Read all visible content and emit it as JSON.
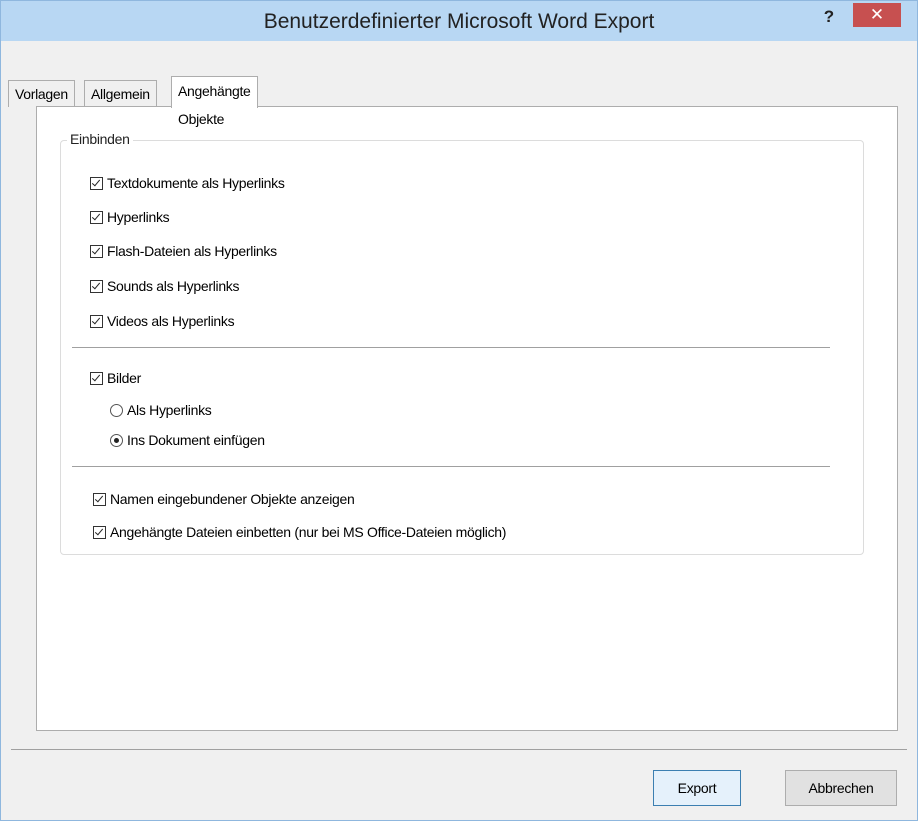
{
  "window": {
    "title": "Benutzerdefinierter Microsoft Word Export",
    "help_label": "?",
    "close_label": "✕"
  },
  "tabs": [
    {
      "label": "Vorlagen",
      "active": false
    },
    {
      "label": "Allgemein",
      "active": false
    },
    {
      "label": "Angehängte Objekte",
      "active": true
    }
  ],
  "group": {
    "label": "Einbinden",
    "hyperlink_options": [
      {
        "label": "Textdokumente als Hyperlinks",
        "checked": true
      },
      {
        "label": "Hyperlinks",
        "checked": true
      },
      {
        "label": "Flash-Dateien als Hyperlinks",
        "checked": true
      },
      {
        "label": "Sounds als Hyperlinks",
        "checked": true
      },
      {
        "label": "Videos als Hyperlinks",
        "checked": true
      }
    ],
    "images": {
      "label": "Bilder",
      "checked": true,
      "radios": [
        {
          "label": "Als Hyperlinks",
          "selected": false
        },
        {
          "label": "Ins Dokument einfügen",
          "selected": true
        }
      ]
    },
    "extra_options": [
      {
        "label": "Namen eingebundener Objekte anzeigen",
        "checked": true
      },
      {
        "label": "Angehängte Dateien einbetten (nur bei MS Office-Dateien möglich)",
        "checked": true
      }
    ]
  },
  "buttons": {
    "export": "Export",
    "cancel": "Abbrechen"
  }
}
